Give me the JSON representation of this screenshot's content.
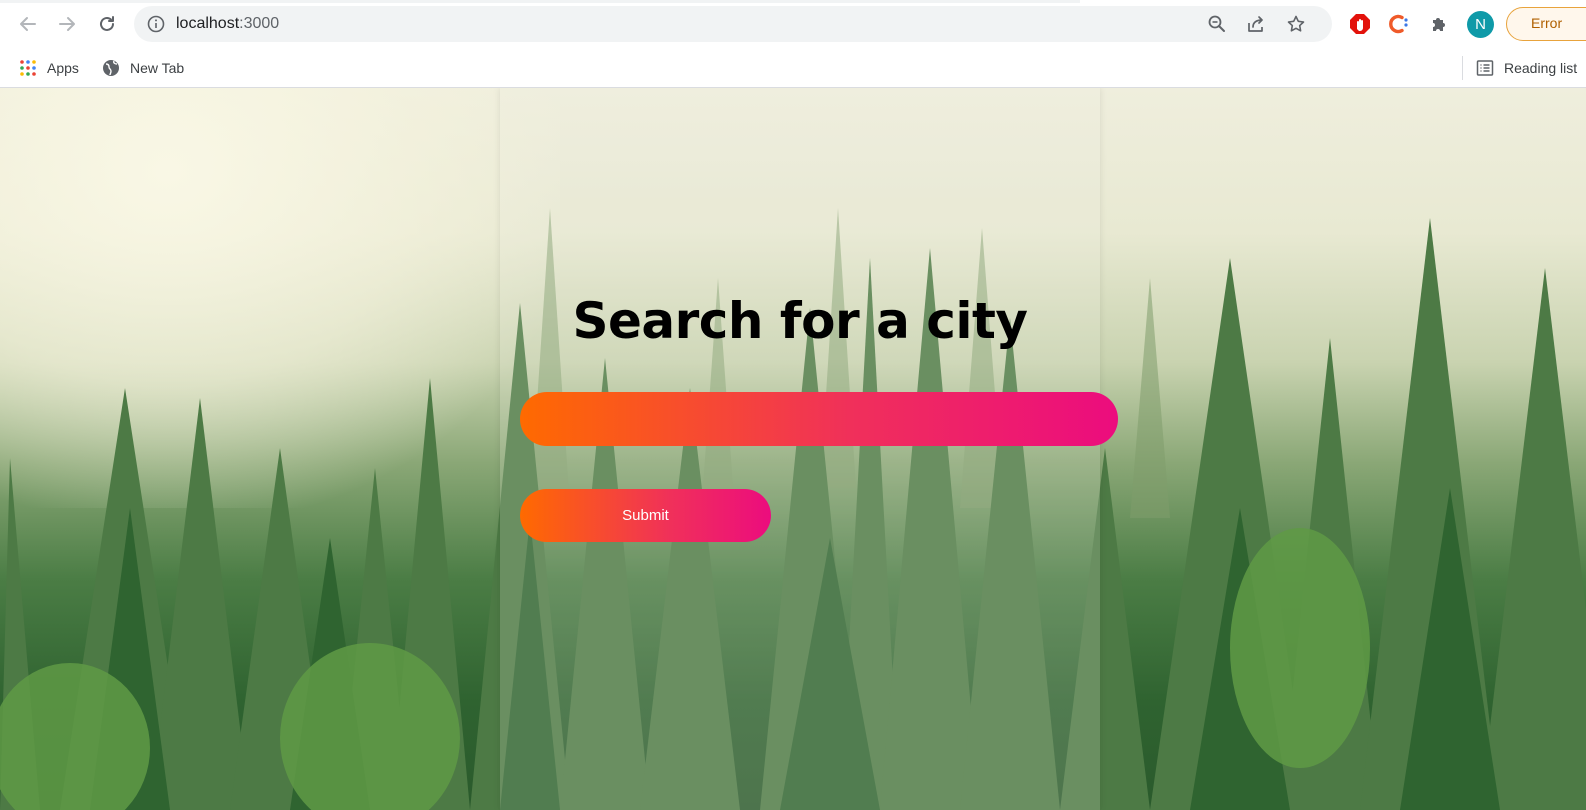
{
  "browser": {
    "url_host": "localhost",
    "url_port": ":3000",
    "avatar_initial": "N",
    "error_label": "Error",
    "bookmarks": {
      "apps_label": "Apps",
      "new_tab_label": "New Tab",
      "reading_list_label": "Reading list"
    }
  },
  "page": {
    "heading": "Search for a city",
    "search_value": "",
    "search_placeholder": "",
    "submit_label": "Submit"
  },
  "colors": {
    "gradient_start": "#ff6a00",
    "gradient_end": "#ec0c7e",
    "avatar": "#0f9aa8",
    "error_accent": "#e8a33c"
  }
}
